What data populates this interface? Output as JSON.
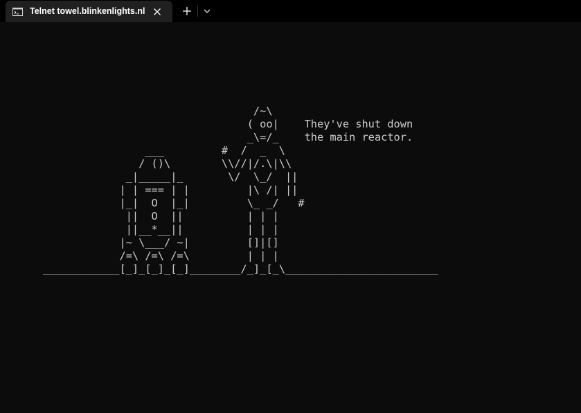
{
  "tab": {
    "title": "Telnet towel.blinkenlights.nl",
    "icon": "terminal-icon"
  },
  "toolbar": {
    "close_icon": "close-icon",
    "new_tab_icon": "plus-icon",
    "dropdown_icon": "chevron-down-icon"
  },
  "terminal": {
    "lines": [
      "                                 /~\\",
      "                                ( oo|    They've shut down",
      "                                _\\=/_    the main reactor.",
      "                ___         #  /  _  \\",
      "               / ()\\        \\\\//|/.\\|\\\\",
      "             _|_____|_       \\/  \\_/  ||",
      "            | | === | |         |\\ /| ||",
      "            |_|  O  |_|         \\_ _/   #",
      "             ||  O  ||          | | |",
      "             ||__*__||          | | |",
      "            |~ \\___/ ~|         []|[]",
      "            /=\\ /=\\ /=\\         | | |",
      "____________[_]_[_]_[_]________/_]_[_\\________________________"
    ]
  },
  "colors": {
    "background": "#0c0c0c",
    "tab_active": "#202020",
    "tabbar": "#000000",
    "text": "#cccccc"
  }
}
